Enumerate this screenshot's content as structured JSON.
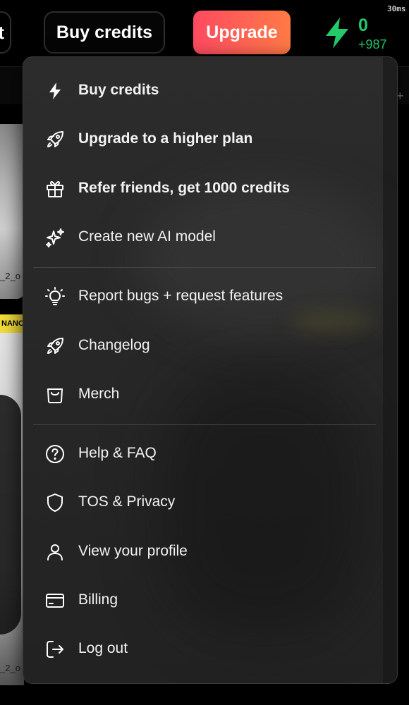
{
  "topbar": {
    "partial_button_label": "t",
    "buy_credits_label": "Buy credits",
    "upgrade_label": "Upgrade",
    "credits_count": "0",
    "credits_delta": "+987",
    "latency": "30ms",
    "accent_green": "#23c96a",
    "upgrade_gradient": [
      "#ff4a62",
      "#ff7a45"
    ]
  },
  "background": {
    "thumb1_label": "_2_o",
    "badge_label": "NANO",
    "thumb2_label": "_2_o",
    "plus_mark": "+"
  },
  "menu": {
    "items": [
      {
        "label": "Buy credits",
        "icon": "lightning-icon",
        "bold": true
      },
      {
        "label": "Upgrade to a higher plan",
        "icon": "rocket-icon",
        "bold": true
      },
      {
        "label": "Refer friends, get 1000 credits",
        "icon": "gift-icon",
        "bold": true
      },
      {
        "label": "Create new AI model",
        "icon": "sparkles-icon",
        "bold": false
      },
      {
        "label": "Report bugs + request features",
        "icon": "lightbulb-icon",
        "bold": false
      },
      {
        "label": "Changelog",
        "icon": "rocket-icon",
        "bold": false
      },
      {
        "label": "Merch",
        "icon": "bag-icon",
        "bold": false
      },
      {
        "label": "Help & FAQ",
        "icon": "question-circle-icon",
        "bold": false
      },
      {
        "label": "TOS & Privacy",
        "icon": "shield-icon",
        "bold": false
      },
      {
        "label": "View your profile",
        "icon": "user-icon",
        "bold": false
      },
      {
        "label": "Billing",
        "icon": "credit-card-icon",
        "bold": false
      },
      {
        "label": "Log out",
        "icon": "logout-icon",
        "bold": false
      }
    ]
  }
}
